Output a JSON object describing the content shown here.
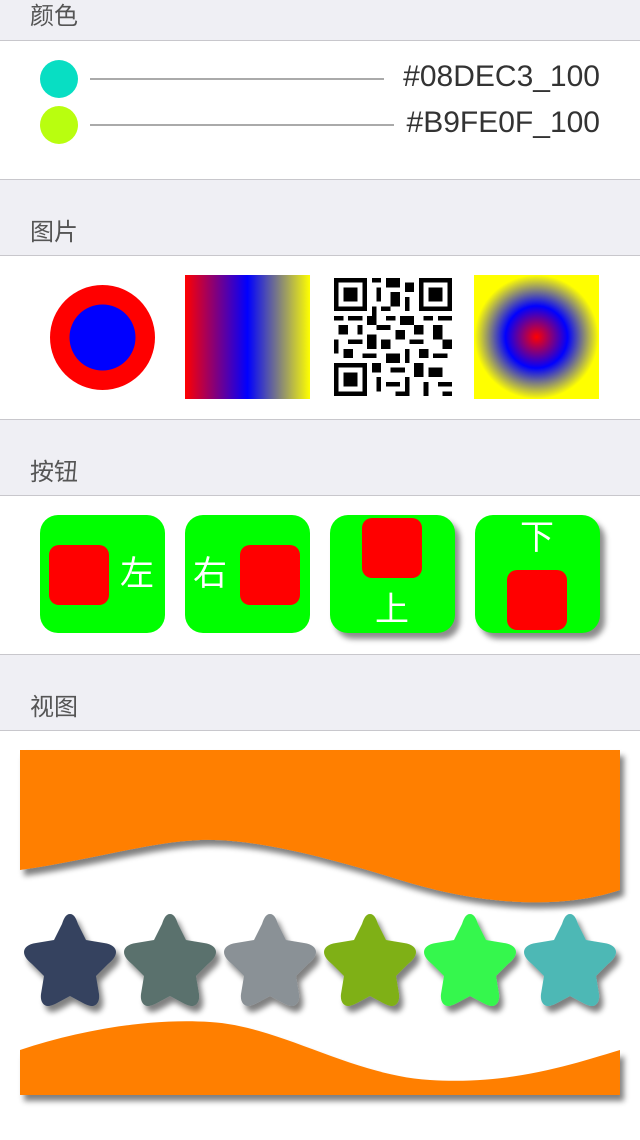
{
  "sections": {
    "colors": {
      "title": "颜色"
    },
    "images": {
      "title": "图片"
    },
    "buttons": {
      "title": "按钮"
    },
    "views": {
      "title": "视图"
    }
  },
  "colors": [
    {
      "swatch": "#08DEC3",
      "label": "#08DEC3_100"
    },
    {
      "swatch": "#B9FE0F",
      "label": "#B9FE0F_100"
    }
  ],
  "images": [
    {
      "icon": "red-blue-ring-icon"
    },
    {
      "icon": "red-blue-yellow-gradient-icon"
    },
    {
      "icon": "qr-code-icon"
    },
    {
      "icon": "radial-gradient-icon"
    }
  ],
  "buttons": [
    {
      "label": "左",
      "image_position": "left"
    },
    {
      "label": "右",
      "image_position": "right"
    },
    {
      "label": "上",
      "image_position": "top"
    },
    {
      "label": "下",
      "image_position": "bottom"
    }
  ],
  "views": {
    "wave_color": "#FF7F00",
    "stars": [
      {
        "color": "#34435E"
      },
      {
        "color": "#5A716D"
      },
      {
        "color": "#8A9196"
      },
      {
        "color": "#7FB016"
      },
      {
        "color": "#36F74E"
      },
      {
        "color": "#4DB8B5"
      }
    ]
  }
}
